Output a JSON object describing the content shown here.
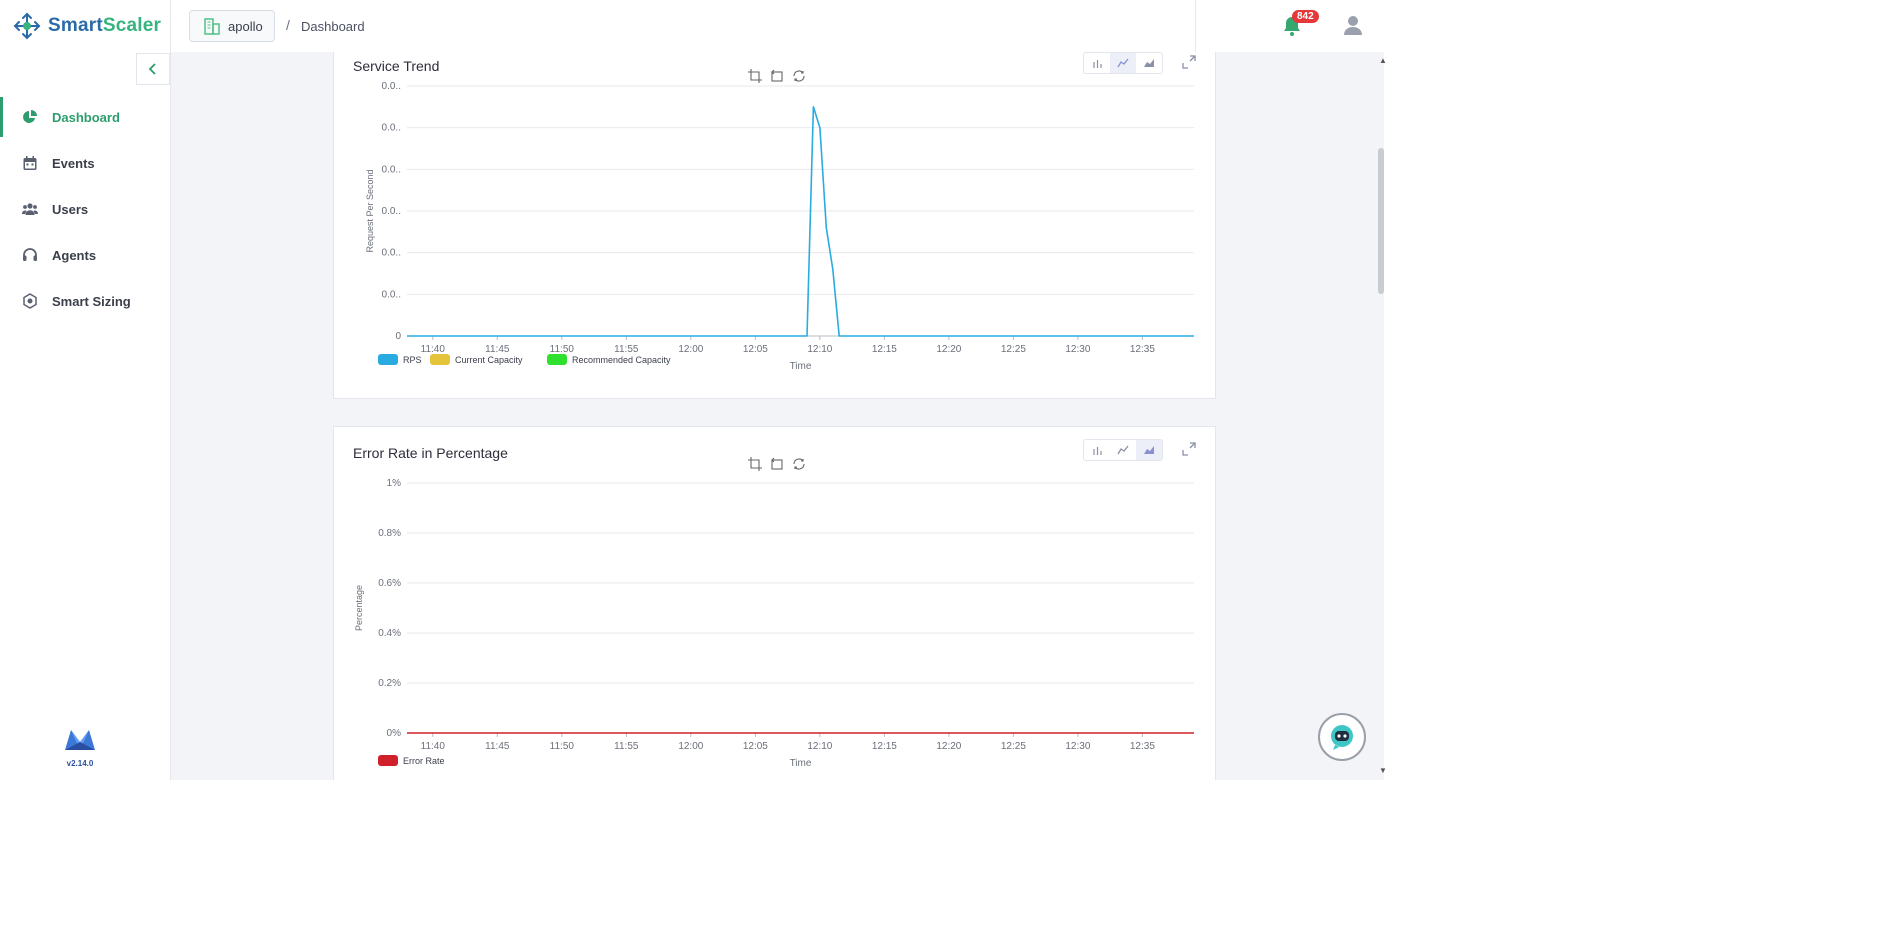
{
  "brand": {
    "name_part1": "Smart",
    "name_part2": "Scaler"
  },
  "header": {
    "project": "apollo",
    "breadcrumb_sep": "/",
    "breadcrumb": "Dashboard",
    "notification_count": "842"
  },
  "sidebar": {
    "items": [
      {
        "label": "Dashboard",
        "icon": "pie-chart-icon",
        "active": true
      },
      {
        "label": "Events",
        "icon": "calendar-icon"
      },
      {
        "label": "Users",
        "icon": "users-icon"
      },
      {
        "label": "Agents",
        "icon": "headset-icon"
      },
      {
        "label": "Smart Sizing",
        "icon": "sizing-icon"
      }
    ],
    "version": "v2.14.0"
  },
  "colors": {
    "accent": "#2e9d6e",
    "rps": "#29abe2",
    "current_capacity": "#e5c33a",
    "recommended_capacity": "#2fe02f",
    "error_rate": "#d0202a"
  },
  "chart_data": [
    {
      "type": "line",
      "title": "Service Trend",
      "xlabel": "Time",
      "ylabel": "Request Per Second",
      "x_ticks": [
        "11:40",
        "11:45",
        "11:50",
        "11:55",
        "12:00",
        "12:05",
        "12:10",
        "12:15",
        "12:20",
        "12:25",
        "12:30",
        "12:35"
      ],
      "y_ticks": [
        "0",
        "0.0..",
        "0.0..",
        "0.0..",
        "0.0..",
        "0.0..",
        "0.0.."
      ],
      "series": [
        {
          "name": "RPS",
          "x": [
            "11:38",
            "12:09",
            "12:09.5",
            "12:10",
            "12:10.5",
            "12:11",
            "12:11.5",
            "12:12",
            "12:39"
          ],
          "values": [
            0,
            0,
            0.055,
            0.05,
            0.026,
            0.016,
            0,
            0,
            0
          ]
        },
        {
          "name": "Current Capacity",
          "x": [],
          "values": []
        },
        {
          "name": "Recommended Capacity",
          "x": [],
          "values": []
        }
      ],
      "grid": true,
      "legend": "bottom-left"
    },
    {
      "type": "area",
      "title": "Error Rate in Percentage",
      "xlabel": "Time",
      "ylabel": "Percentage",
      "x_ticks": [
        "11:40",
        "11:45",
        "11:50",
        "11:55",
        "12:00",
        "12:05",
        "12:10",
        "12:15",
        "12:20",
        "12:25",
        "12:30",
        "12:35"
      ],
      "y_ticks": [
        "0%",
        "0.2%",
        "0.4%",
        "0.6%",
        "0.8%",
        "1%"
      ],
      "ylim": [
        0,
        1
      ],
      "series": [
        {
          "name": "Error Rate",
          "x": [
            "11:38",
            "12:39"
          ],
          "values": [
            0,
            0
          ]
        }
      ],
      "grid": true,
      "legend": "bottom-left"
    }
  ]
}
